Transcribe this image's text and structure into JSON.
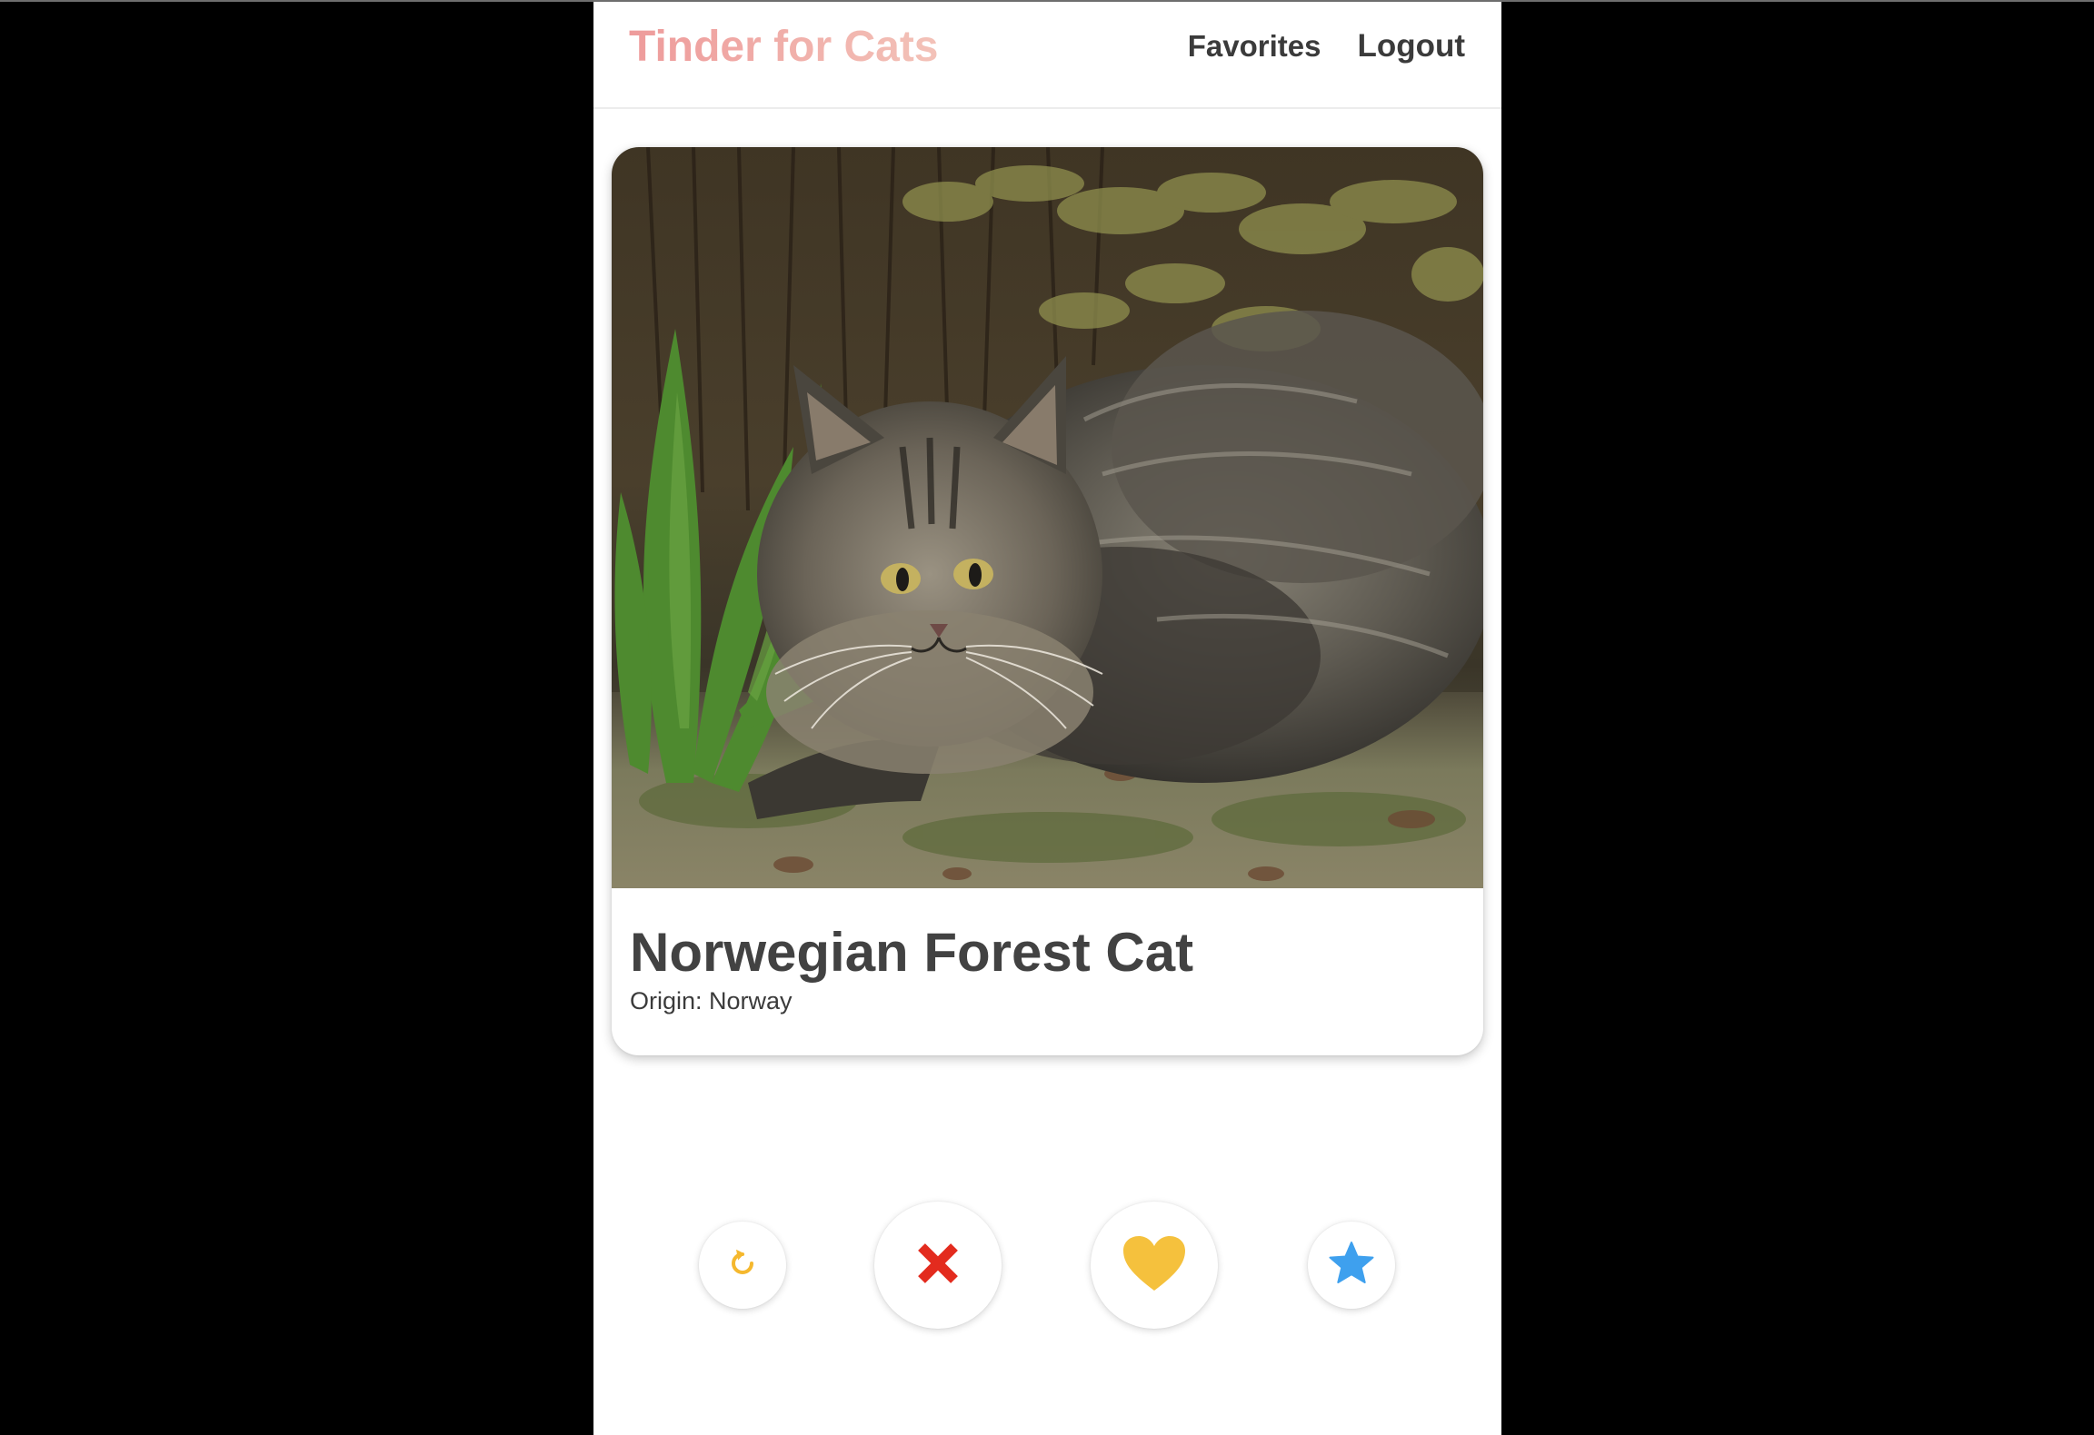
{
  "navbar": {
    "brand": "Tinder for Cats",
    "links": [
      {
        "label": "Favorites"
      },
      {
        "label": "Logout"
      }
    ]
  },
  "card": {
    "breed_name": "Norwegian Forest Cat",
    "origin": "Origin: Norway"
  },
  "actions": [
    {
      "icon": "undo-icon",
      "color": "#f5b82e"
    },
    {
      "icon": "close-icon",
      "color": "#e32b1e"
    },
    {
      "icon": "heart-icon",
      "color": "#f5c13d"
    },
    {
      "icon": "star-icon",
      "color": "#3ea0ee"
    }
  ],
  "colors": {
    "brand_start": "#ee9b9b",
    "brand_end": "#f3c2b8",
    "text": "#424242",
    "background": "#000000",
    "app_background": "#ffffff"
  }
}
